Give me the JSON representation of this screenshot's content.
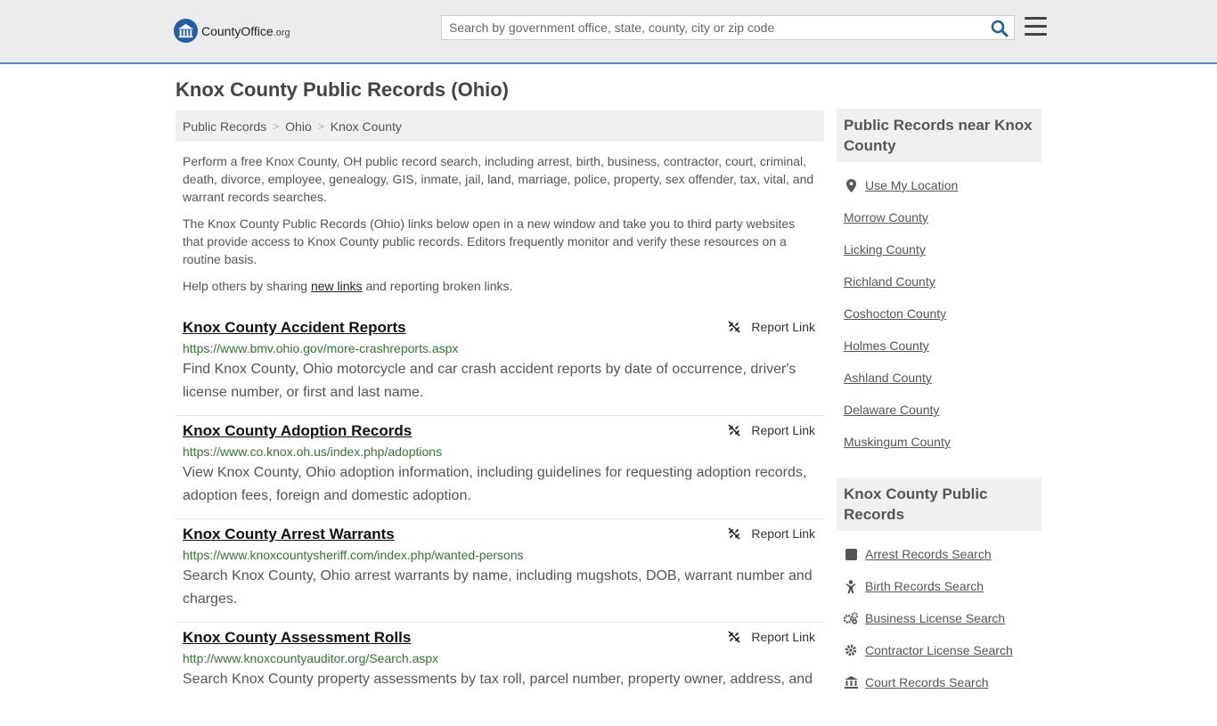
{
  "header": {
    "logo_main": "CountyOffice",
    "logo_tld": ".org",
    "search_placeholder": "Search by government office, state, county, city or zip code"
  },
  "page_title": "Knox County Public Records (Ohio)",
  "breadcrumb": [
    "Public Records",
    "Ohio",
    "Knox County"
  ],
  "intro": {
    "p1": "Perform a free Knox County, OH public record search, including arrest, birth, business, contractor, court, criminal, death, divorce, employee, genealogy, GIS, inmate, jail, land, marriage, police, property, sex offender, tax, vital, and warrant records searches.",
    "p2": "The Knox County Public Records (Ohio) links below open in a new window and take you to third party websites that provide access to Knox County public records. Editors frequently monitor and verify these resources on a routine basis.",
    "p3_before": "Help others by sharing ",
    "p3_link": "new links",
    "p3_after": " and reporting broken links."
  },
  "report_label": "Report Link",
  "records": [
    {
      "title": "Knox County Accident Reports",
      "url": "https://www.bmv.ohio.gov/more-crashreports.aspx",
      "desc": "Find Knox County, Ohio motorcycle and car crash accident reports by date of occurrence, driver's license number, or first and last name."
    },
    {
      "title": "Knox County Adoption Records",
      "url": "https://www.co.knox.oh.us/index.php/adoptions",
      "desc": "View Knox County, Ohio adoption information, including guidelines for requesting adoption records, adoption fees, foreign and domestic adoption."
    },
    {
      "title": "Knox County Arrest Warrants",
      "url": "https://www.knoxcountysheriff.com/index.php/wanted-persons",
      "desc": "Search Knox County, Ohio arrest warrants by name, including mugshots, DOB, warrant number and charges."
    },
    {
      "title": "Knox County Assessment Rolls",
      "url": "http://www.knoxcountyauditor.org/Search.aspx",
      "desc": "Search Knox County property assessments by tax roll, parcel number, property owner, address, and"
    }
  ],
  "sidebar": {
    "nearby_title": "Public Records near Knox County",
    "use_location": "Use My Location",
    "nearby": [
      "Morrow County",
      "Licking County",
      "Richland County",
      "Coshocton County",
      "Holmes County",
      "Ashland County",
      "Delaware County",
      "Muskingum County"
    ],
    "records_title": "Knox County Public Records",
    "record_links": [
      {
        "label": "Arrest Records Search",
        "icon": "square-icon"
      },
      {
        "label": "Birth Records Search",
        "icon": "baby-icon"
      },
      {
        "label": "Business License Search",
        "icon": "gears-icon"
      },
      {
        "label": "Contractor License Search",
        "icon": "gear-icon"
      },
      {
        "label": "Court Records Search",
        "icon": "courthouse-icon"
      }
    ]
  }
}
